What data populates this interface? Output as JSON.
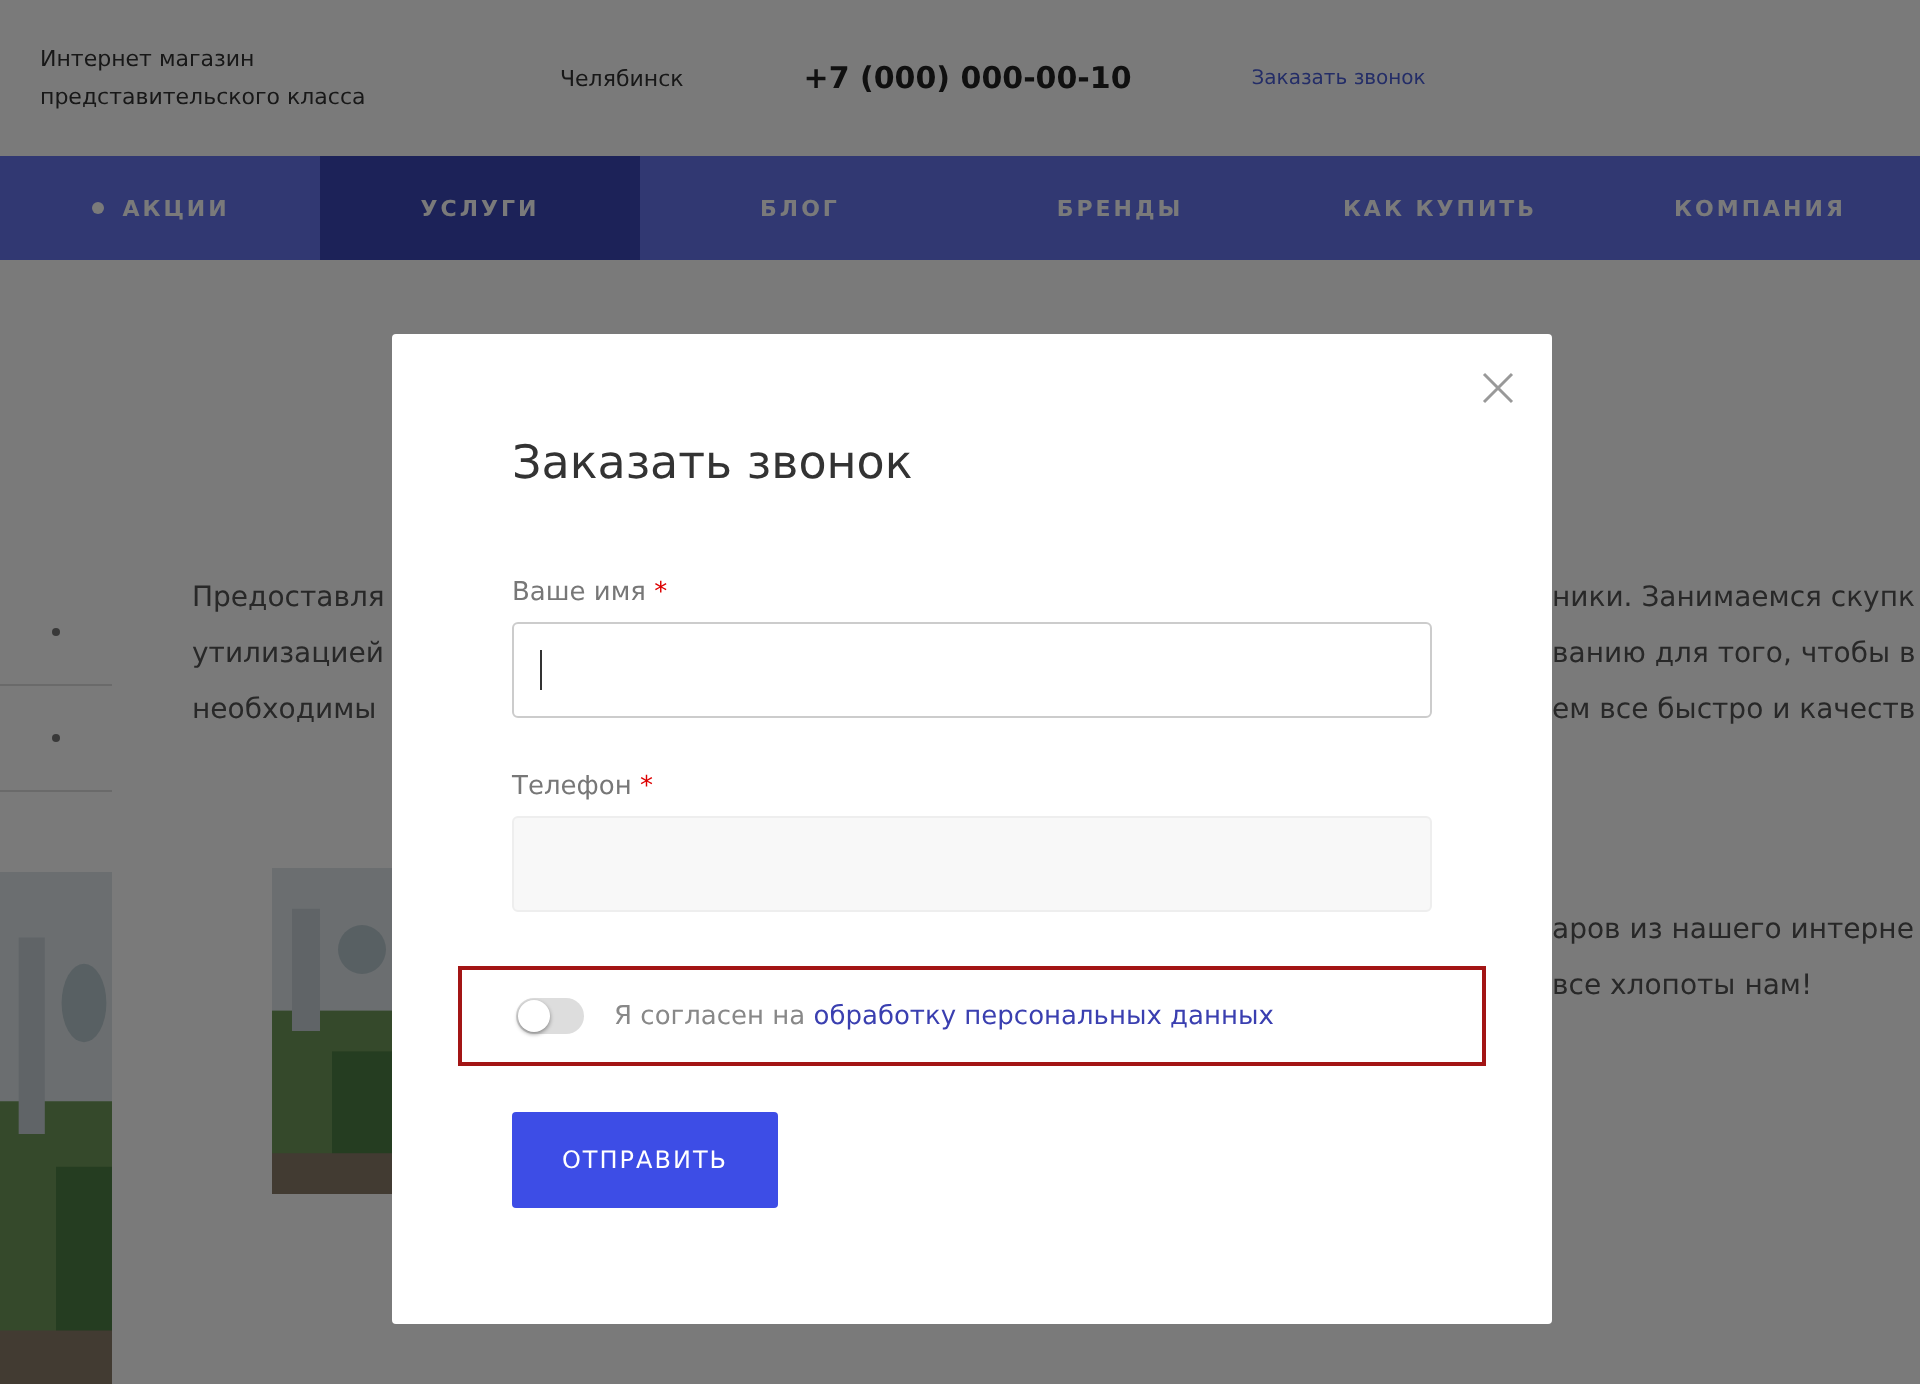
{
  "header": {
    "tagline": [
      "Интернет магазин",
      "представительского класса"
    ],
    "city": "Челябинск",
    "phone": "+7 (000) 000-00-10",
    "callback_link": "Заказать звонок"
  },
  "nav": [
    {
      "label": "АКЦИИ",
      "selected": false,
      "icon": true
    },
    {
      "label": "УСЛУГИ",
      "selected": true
    },
    {
      "label": "БЛОГ",
      "selected": false
    },
    {
      "label": "БРЕНДЫ",
      "selected": false
    },
    {
      "label": "КАК КУПИТЬ",
      "selected": false
    },
    {
      "label": "КОМПАНИЯ",
      "selected": false
    }
  ],
  "body": {
    "left_lines": [
      "Предоставля",
      "утилизацией",
      "необходимы"
    ],
    "right_lines": [
      "ники. Занимаемся скупк",
      "ванию для того, чтобы в",
      "ем все быстро и качеств"
    ],
    "right_lines_2": [
      "аров из нашего интерне",
      "все хлопоты нам!"
    ]
  },
  "modal": {
    "title": "Заказать звонок",
    "fields": [
      {
        "label": "Ваше имя",
        "required_mark": "*",
        "focused": true
      },
      {
        "label": "Телефон",
        "required_mark": "*",
        "focused": false
      }
    ],
    "consent": {
      "checked": false,
      "text": "Я согласен на",
      "link": "обработку персональных данных",
      "highlighted": true
    },
    "submit": "ОТПРАВИТЬ"
  }
}
